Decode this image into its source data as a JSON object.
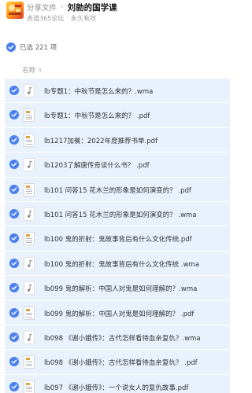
{
  "header": {
    "breadcrumb_link": "分享文件",
    "breadcrumb_sep": "›",
    "title": "刘勍的国学课",
    "source": "赤道365论坛",
    "source_sep": "·",
    "validity": "永久有效",
    "avatar_icon": "avatar-image"
  },
  "selection": {
    "label": "已选 221 项",
    "accent": "#4a7ff0"
  },
  "columns": {
    "name_label": "名称"
  },
  "rows": [
    {
      "name": "lb专题1：中秋节是怎么来的？.wma",
      "type": "audio"
    },
    {
      "name": "lb专题1：中秋节是怎么来的？ .pdf",
      "type": "doc"
    },
    {
      "name": "lb1217加餐：2022年度推荐书单.pdf",
      "type": "doc"
    },
    {
      "name": "lb1203了解唐传奇读什么书？ .pdf",
      "type": "audio"
    },
    {
      "name": "lb101 问答15 花木兰的形象是如何演变的？ .pdf",
      "type": "doc"
    },
    {
      "name": "lb101 问答15 花木兰的形象是如何演变的？ .wma",
      "type": "audio"
    },
    {
      "name": "lb100 鬼的折射：鬼故事背后有什么文化传统.pdf",
      "type": "doc"
    },
    {
      "name": "lb100 鬼的折射：鬼故事背后有什么文化传统 .wma",
      "type": "audio"
    },
    {
      "name": "lb099 鬼的解析：中国人对鬼是如何理解的？.wma",
      "type": "audio"
    },
    {
      "name": "lb099 鬼的解析：中国人对鬼是如何理解的？ .pdf",
      "type": "doc"
    },
    {
      "name": "lb098 《谢小娥传》：古代怎样看待血亲复仇？.wma",
      "type": "audio"
    },
    {
      "name": "lb098 《谢小娥传》：古代怎样看待血亲复仇？ .pdf",
      "type": "doc"
    },
    {
      "name": "lb097 《谢小娥传》：一个说女人的复仇故事.pdf",
      "type": "doc"
    }
  ]
}
